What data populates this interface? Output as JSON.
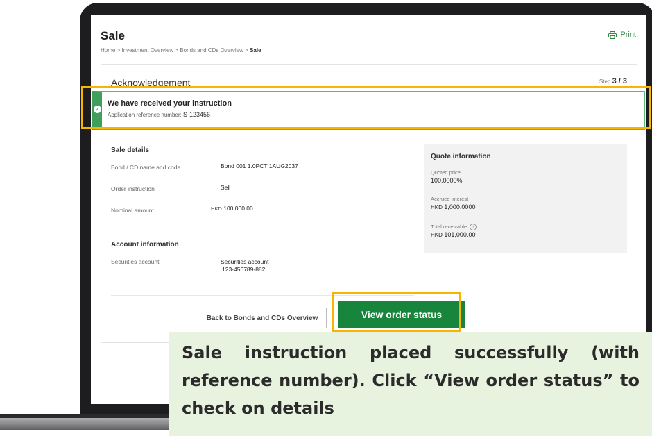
{
  "header": {
    "title": "Sale",
    "print_label": "Print",
    "breadcrumb": [
      "Home",
      "Investment Overview",
      "Bonds and CDs Overview",
      "Sale"
    ],
    "breadcrumb_separator": ">"
  },
  "card": {
    "title": "Acknowledgement",
    "step_prefix": "Step",
    "step_value": "3 / 3"
  },
  "banner": {
    "title": "We have received your instruction",
    "ref_label": "Application reference number:",
    "ref_number": "S-123456"
  },
  "sale_details": {
    "heading": "Sale details",
    "rows": [
      {
        "label": "Bond / CD name and code",
        "value": "Bond 001 1.0PCT 1AUG2037"
      },
      {
        "label": "Order instruction",
        "value": "Sell"
      },
      {
        "label": "Nominal amount",
        "currency": "HKD",
        "value": "100,000.00"
      }
    ]
  },
  "account_info": {
    "heading": "Account information",
    "label": "Securities account",
    "value_line1": "Securities account",
    "value_line2": "123-456789-882"
  },
  "quote": {
    "heading": "Quote information",
    "quoted_price_label": "Quoted price",
    "quoted_price": "100.0000%",
    "accrued_label": "Accrued interest",
    "accrued_currency": "HKD",
    "accrued_value": "1,000.0000",
    "total_label": "Total receivable",
    "total_currency": "HKD",
    "total_value": "101,000.00",
    "info_icon": "i"
  },
  "buttons": {
    "back_label": "Back to Bonds and CDs Overview",
    "view_status_label": "View order status"
  },
  "callout": {
    "text": "Sale instruction placed successfully (with reference number). Click “View order status” to check on details"
  },
  "colors": {
    "accent_green": "#17853c",
    "highlight": "#f7b500",
    "callout_bg": "#e7f3df"
  }
}
